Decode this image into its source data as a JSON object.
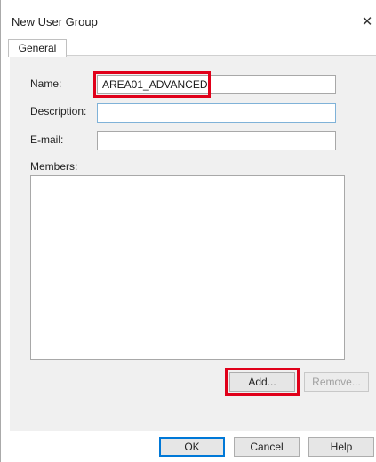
{
  "dialog": {
    "title": "New User Group",
    "tab": "General",
    "name": {
      "label": "Name:",
      "value": "AREA01_ADVANCED"
    },
    "description": {
      "label": "Description:",
      "value": ""
    },
    "email": {
      "label": "E-mail:",
      "value": ""
    },
    "members": {
      "label": "Members:"
    },
    "buttons": {
      "add": "Add...",
      "remove": "Remove...",
      "ok": "OK",
      "cancel": "Cancel",
      "help": "Help"
    },
    "highlight_color": "#e0001a"
  }
}
